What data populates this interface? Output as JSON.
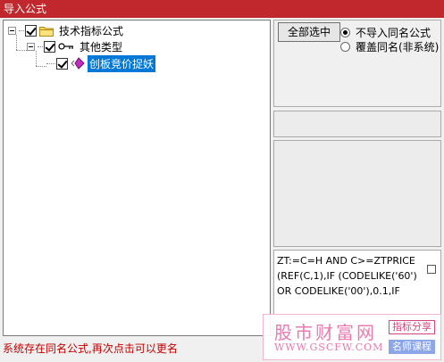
{
  "window": {
    "title": "导入公式"
  },
  "tree": {
    "root": {
      "label": "技术指标公式",
      "checked": true
    },
    "child": {
      "label": "其他类型",
      "checked": true
    },
    "leaf": {
      "label": "创板竞价捉妖",
      "checked": true,
      "selected": true
    }
  },
  "options": {
    "select_all_label": "全部选中",
    "radio_no_import": "不导入同名公式",
    "radio_overwrite": "覆盖同名(非系统)"
  },
  "code": {
    "text": "ZT:=C=H AND C>=ZTPRICE(REF(C,1),IF (CODELIKE('60') OR CODELIKE('00'),0.1,IF"
  },
  "status": {
    "text": "系统存在同名公式,再次点击可以更名"
  },
  "watermark": {
    "title": "股市财富网",
    "url": "WWW.GSCFW.COM",
    "tag1": "指标分享",
    "tag2": "名师课程"
  },
  "colors": {
    "titlebar": "#c0282d",
    "selection": "#0078d7",
    "status_text": "#c00000"
  }
}
